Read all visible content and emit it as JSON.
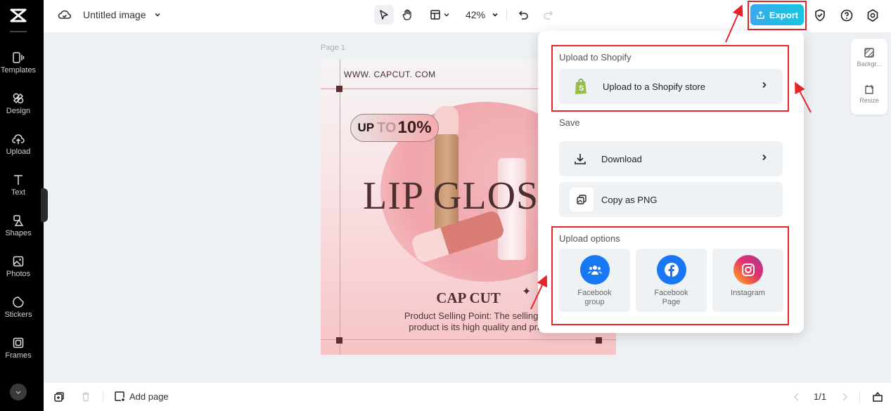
{
  "app": {
    "title": "Untitled image"
  },
  "sidebar": {
    "items": [
      {
        "label": "Templates",
        "icon": "templates-icon"
      },
      {
        "label": "Design",
        "icon": "design-icon"
      },
      {
        "label": "Upload",
        "icon": "upload-icon"
      },
      {
        "label": "Text",
        "icon": "text-icon"
      },
      {
        "label": "Shapes",
        "icon": "shapes-icon"
      },
      {
        "label": "Photos",
        "icon": "photos-icon"
      },
      {
        "label": "Stickers",
        "icon": "stickers-icon"
      },
      {
        "label": "Frames",
        "icon": "frames-icon"
      }
    ]
  },
  "toolbar": {
    "zoom": "42%",
    "export_label": "Export"
  },
  "canvas": {
    "page_label": "Page 1",
    "poster": {
      "url": "WWW. CAPCUT. COM",
      "badge_up": "UP",
      "badge_to": "TO",
      "badge_pct": "10%",
      "headline": "LIP GLOSS",
      "brand": "CAP CUT",
      "selling_line1": "Product Selling Point: The selling point",
      "selling_line2": "product is its high quality and practic"
    }
  },
  "right_panel": {
    "items": [
      {
        "label": "Backgr..."
      },
      {
        "label": "Resize"
      }
    ]
  },
  "export_menu": {
    "shopify_section": "Upload to Shopify",
    "shopify_button": "Upload to a Shopify store",
    "save_section": "Save",
    "download": "Download",
    "copy_png": "Copy as PNG",
    "upload_section": "Upload options",
    "upload_options": [
      {
        "label": "Facebook group",
        "color": "#1877f2"
      },
      {
        "label": "Facebook Page",
        "color": "#1877f2"
      },
      {
        "label": "Instagram",
        "color": "#e1306c"
      }
    ]
  },
  "bottom_bar": {
    "add_page": "Add page",
    "page_indicator": "1/1"
  },
  "colors": {
    "accent": "#1fb8e4",
    "highlight": "#e8242b",
    "shopify": "#95bf47"
  }
}
